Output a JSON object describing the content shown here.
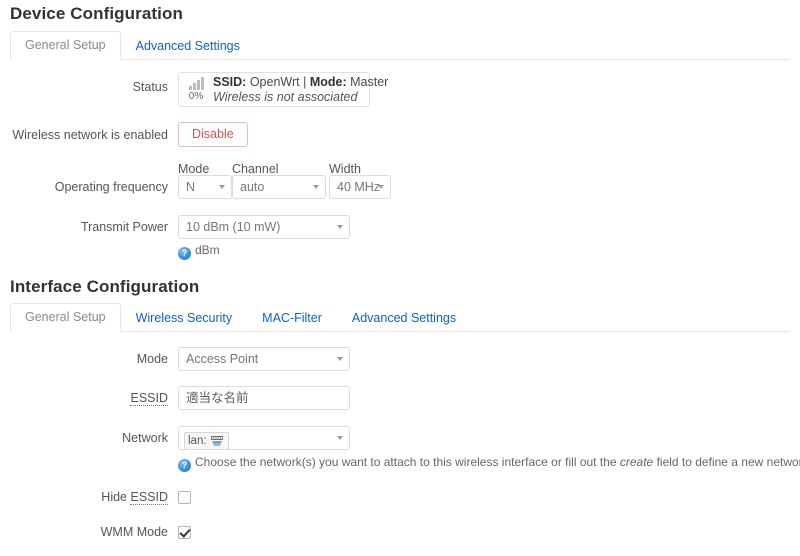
{
  "device_section": {
    "title": "Device Configuration",
    "tabs": [
      {
        "label": "General Setup",
        "active": true
      },
      {
        "label": "Advanced Settings",
        "active": false
      }
    ],
    "status": {
      "label": "Status",
      "signal_percent": "0%",
      "ssid_key": "SSID:",
      "ssid_value": "OpenWrt",
      "separator": "|",
      "mode_key": "Mode:",
      "mode_value": "Master",
      "association": "Wireless is not associated",
      "icon": "signal-bars-icon"
    },
    "enabled_row": {
      "label": "Wireless network is enabled",
      "button_label": "Disable",
      "button_color": "#d9534f"
    },
    "operating_frequency": {
      "label": "Operating frequency",
      "mode": {
        "label": "Mode",
        "value": "N"
      },
      "channel": {
        "label": "Channel",
        "value": "auto"
      },
      "width": {
        "label": "Width",
        "value": "40 MHz"
      }
    },
    "transmit_power": {
      "label": "Transmit Power",
      "value": "10 dBm (10 mW)",
      "hint": "dBm",
      "hint_icon": "help-icon"
    }
  },
  "interface_section": {
    "title": "Interface Configuration",
    "tabs": [
      {
        "label": "General Setup",
        "active": true
      },
      {
        "label": "Wireless Security",
        "active": false
      },
      {
        "label": "MAC-Filter",
        "active": false
      },
      {
        "label": "Advanced Settings",
        "active": false
      }
    ],
    "mode": {
      "label": "Mode",
      "value": "Access Point"
    },
    "essid": {
      "label": "ESSID",
      "value": "適当な名前"
    },
    "network": {
      "label": "Network",
      "tag_label": "lan:",
      "tag_icon": "ethernet-icon",
      "hint_icon": "help-icon",
      "hint_before": "Choose the network(s) you want to attach to this wireless interface or fill out the ",
      "hint_italic": "create",
      "hint_after": " field to define a new network."
    },
    "hide_essid": {
      "label_prefix": "Hide ",
      "label_abbr": "ESSID",
      "checked": false
    },
    "wmm_mode": {
      "label": "WMM Mode",
      "checked": true
    }
  }
}
